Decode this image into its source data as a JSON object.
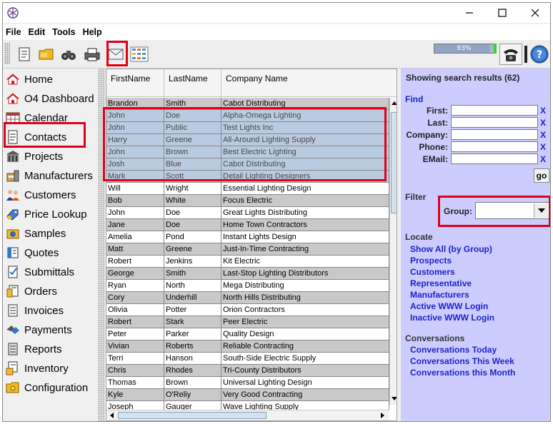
{
  "menu": [
    "File",
    "Edit",
    "Tools",
    "Help"
  ],
  "toolbar": {
    "progress_text": "93%",
    "progress_fraction": 0.93
  },
  "sidebar": {
    "items": [
      {
        "label": "Home",
        "icon": "house-icon"
      },
      {
        "label": "O4 Dashboard",
        "icon": "dashboard-icon"
      },
      {
        "label": "Calendar",
        "icon": "calendar-icon"
      },
      {
        "label": "Contacts",
        "icon": "contact-card-icon"
      },
      {
        "label": "Projects",
        "icon": "building-icon"
      },
      {
        "label": "Manufacturers",
        "icon": "factory-icon"
      },
      {
        "label": "Customers",
        "icon": "people-icon"
      },
      {
        "label": "Price Lookup",
        "icon": "price-tag-icon"
      },
      {
        "label": "Samples",
        "icon": "samples-icon"
      },
      {
        "label": "Quotes",
        "icon": "quote-icon"
      },
      {
        "label": "Submittals",
        "icon": "submittal-icon"
      },
      {
        "label": "Orders",
        "icon": "order-icon"
      },
      {
        "label": "Invoices",
        "icon": "invoice-icon"
      },
      {
        "label": "Payments",
        "icon": "payment-icon"
      },
      {
        "label": "Reports",
        "icon": "report-icon"
      },
      {
        "label": "Inventory",
        "icon": "inventory-icon"
      },
      {
        "label": "Configuration",
        "icon": "folder-gear-icon"
      }
    ]
  },
  "table": {
    "columns": [
      "FirstName",
      "LastName",
      "Company Name"
    ],
    "rows": [
      [
        "Brandon",
        "Smith",
        "Cabot Distributing"
      ],
      [
        "John",
        "Doe",
        "Alpha-Omega Lighting"
      ],
      [
        "John",
        "Public",
        "Test Lights Inc"
      ],
      [
        "Harry",
        "Greene",
        "All-Around Lighting Supply"
      ],
      [
        "John",
        "Brown",
        "Best Electric Lighting"
      ],
      [
        "Josh",
        "Blue",
        "Cabot Distributing"
      ],
      [
        "Mark",
        "Scott",
        "Detail Lighting Designers"
      ],
      [
        "Will",
        "Wright",
        "Essential Lighting Design"
      ],
      [
        "Bob",
        "White",
        "Focus Electric"
      ],
      [
        "John",
        "Doe",
        "Great Lights Distributing"
      ],
      [
        "Jane",
        "Doe",
        "Home Town Contractors"
      ],
      [
        "Amelia",
        "Pond",
        "Instant Lights Design"
      ],
      [
        "Matt",
        "Greene",
        "Just-In-Time Contracting"
      ],
      [
        "Robert",
        "Jenkins",
        "Kit Electric"
      ],
      [
        "George",
        "Smith",
        "Last-Stop Lighting Distributors"
      ],
      [
        "Ryan",
        "North",
        "Mega Distributing"
      ],
      [
        "Cory",
        "Underhill",
        "North Hills Distributing"
      ],
      [
        "Olivia",
        "Potter",
        "Orion Contractors"
      ],
      [
        "Robert",
        "Stark",
        "Peer Electric"
      ],
      [
        "Peter",
        "Parker",
        "Quality Design"
      ],
      [
        "Vivian",
        "Roberts",
        "Reliable Contracting"
      ],
      [
        "Terri",
        "Hanson",
        "South-Side Electric Supply"
      ],
      [
        "Chris",
        "Rhodes",
        "Tri-County Distributors"
      ],
      [
        "Thomas",
        "Brown",
        "Universal Lighting Design"
      ],
      [
        "Kyle",
        "O'Reliy",
        "Very Good Contracting"
      ],
      [
        "Joseph",
        "Gauger",
        "Wave Lighting Supply"
      ]
    ]
  },
  "panel": {
    "title": "Showing search results (62)",
    "find_heading": "Find",
    "fields": [
      {
        "label": "First:",
        "value": ""
      },
      {
        "label": "Last:",
        "value": ""
      },
      {
        "label": "Company:",
        "value": ""
      },
      {
        "label": "Phone:",
        "value": ""
      },
      {
        "label": "EMail:",
        "value": ""
      }
    ],
    "clear_label": "X",
    "go_label": "go",
    "filter_heading": "Filter",
    "group_label": "Group:",
    "group_value": "",
    "locate_heading": "Locate",
    "locate_links": [
      "Show All (by Group)",
      "Prospects",
      "Customers",
      "Representative",
      "Manufacturers",
      "Active WWW Login",
      "Inactive WWW Login"
    ],
    "conversations_heading": "Conversations",
    "conversation_links": [
      "Conversations Today",
      "Conversations This Week",
      "Conversations this Month"
    ]
  },
  "colors": {
    "panel_bg": "#ccccff",
    "link": "#1e24c8",
    "highlight": "#e0001a",
    "selected_row": "#b9cbe1"
  }
}
